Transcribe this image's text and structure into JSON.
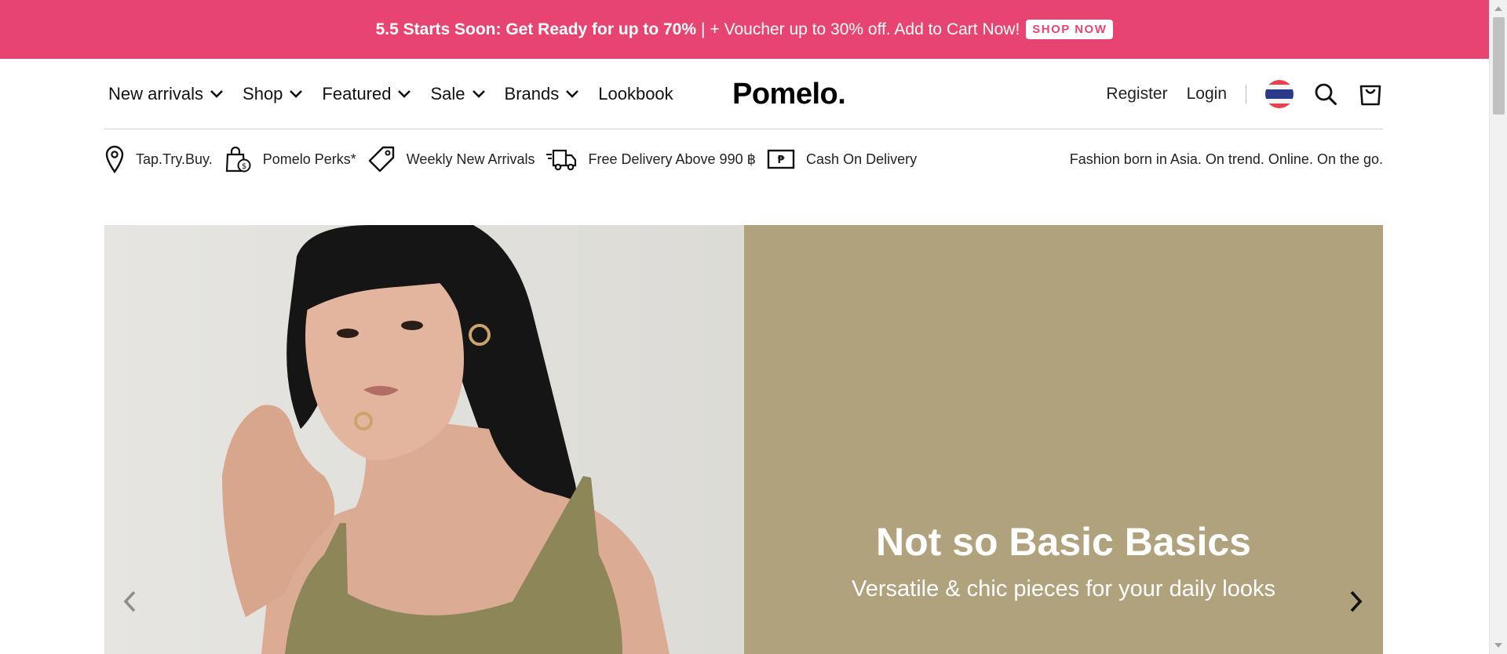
{
  "promo": {
    "bold_text": "5.5 Starts Soon: Get Ready for up to 70%",
    "separator": "|",
    "rest_text": "+ Voucher up to 30% off. Add to Cart Now!",
    "button_label": "SHOP NOW",
    "background": "#e84471"
  },
  "header": {
    "nav": [
      {
        "label": "New arrivals",
        "dropdown": true
      },
      {
        "label": "Shop",
        "dropdown": true
      },
      {
        "label": "Featured",
        "dropdown": true
      },
      {
        "label": "Sale",
        "dropdown": true
      },
      {
        "label": "Brands",
        "dropdown": true
      },
      {
        "label": "Lookbook",
        "dropdown": false
      }
    ],
    "logo": "Pomelo.",
    "register_label": "Register",
    "login_label": "Login",
    "divider": "|"
  },
  "perks": {
    "items": [
      {
        "icon": "location-pin-icon",
        "label": "Tap.Try.Buy."
      },
      {
        "icon": "perks-bag-icon",
        "label": "Pomelo Perks*"
      },
      {
        "icon": "price-tag-icon",
        "label": "Weekly New Arrivals"
      },
      {
        "icon": "delivery-truck-icon",
        "label": "Free Delivery Above 990 ฿"
      },
      {
        "icon": "cash-icon",
        "label": "Cash On Delivery"
      }
    ],
    "tagline": "Fashion born in Asia. On trend. Online. On the go."
  },
  "hero": {
    "title": "Not so Basic Basics",
    "subtitle": "Versatile & chic pieces for your daily looks",
    "panel_color": "#b0a27c"
  }
}
